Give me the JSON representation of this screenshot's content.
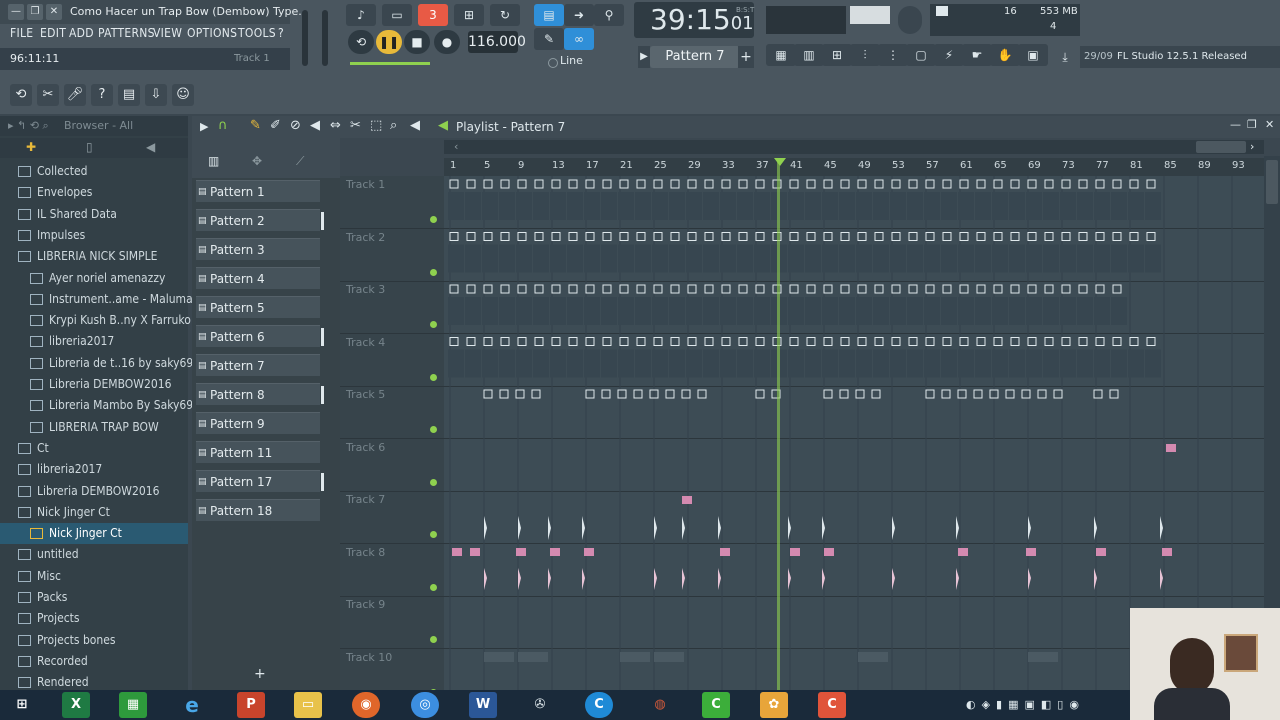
{
  "window": {
    "title": "Como Hacer un  Trap Bow (Dembow) Type..."
  },
  "menu": [
    "FILE",
    "EDIT",
    "ADD",
    "PATTERNS",
    "VIEW",
    "OPTIONS",
    "TOOLS",
    "?"
  ],
  "hint": {
    "position": "96:11:11",
    "track": "Track 1"
  },
  "transport": {
    "tempo": "116.000",
    "time": "39:15",
    "time_small": "01",
    "bst": "B:S:T",
    "snap": "Line"
  },
  "pattern_selector": "Pattern 7",
  "status": {
    "cpu": "16",
    "memory": "553 MB",
    "polyphony": "4"
  },
  "news": {
    "date": "29/09",
    "text": "FL Studio 12.5.1 Released"
  },
  "browser": {
    "header": "Browser - All",
    "items": [
      {
        "label": "Collected",
        "level": 0,
        "selected": false
      },
      {
        "label": "Envelopes",
        "level": 0,
        "selected": false
      },
      {
        "label": "IL Shared Data",
        "level": 0,
        "selected": false
      },
      {
        "label": "Impulses",
        "level": 0,
        "selected": false
      },
      {
        "label": "LIBRERIA NICK SIMPLE",
        "level": 0,
        "selected": false
      },
      {
        "label": "Ayer noriel amenazzy",
        "level": 1,
        "selected": false
      },
      {
        "label": "Instrument..ame - Maluma",
        "level": 1,
        "selected": false
      },
      {
        "label": "Krypi Kush B..ny X Farruko",
        "level": 1,
        "selected": false
      },
      {
        "label": "libreria2017",
        "level": 1,
        "selected": false
      },
      {
        "label": "Libreria de t..16 by saky69",
        "level": 1,
        "selected": false
      },
      {
        "label": "Libreria DEMBOW2016",
        "level": 1,
        "selected": false
      },
      {
        "label": "Libreria Mambo By Saky69",
        "level": 1,
        "selected": false
      },
      {
        "label": "LIBRERIA TRAP BOW",
        "level": 1,
        "selected": false
      },
      {
        "label": "Ct",
        "level": 0,
        "selected": false
      },
      {
        "label": "libreria2017",
        "level": 0,
        "selected": false
      },
      {
        "label": "Libreria DEMBOW2016",
        "level": 0,
        "selected": false
      },
      {
        "label": "Nick Jinger Ct",
        "level": 0,
        "selected": false
      },
      {
        "label": "Nick Jinger Ct",
        "level": 1,
        "selected": true
      },
      {
        "label": "untitled",
        "level": 0,
        "selected": false
      },
      {
        "label": "Misc",
        "level": 0,
        "selected": false
      },
      {
        "label": "Packs",
        "level": 0,
        "selected": false
      },
      {
        "label": "Projects",
        "level": 0,
        "selected": false
      },
      {
        "label": "Projects bones",
        "level": 0,
        "selected": false
      },
      {
        "label": "Recorded",
        "level": 0,
        "selected": false
      },
      {
        "label": "Rendered",
        "level": 0,
        "selected": false
      }
    ]
  },
  "patterns": [
    {
      "label": "Pattern 1",
      "active": false
    },
    {
      "label": "Pattern 2",
      "active": true
    },
    {
      "label": "Pattern 3",
      "active": false
    },
    {
      "label": "Pattern 4",
      "active": false
    },
    {
      "label": "Pattern 5",
      "active": false
    },
    {
      "label": "Pattern 6",
      "active": true
    },
    {
      "label": "Pattern 7",
      "active": false
    },
    {
      "label": "Pattern 8",
      "active": true
    },
    {
      "label": "Pattern 9",
      "active": false
    },
    {
      "label": "Pattern 11",
      "active": false
    },
    {
      "label": "Pattern 17",
      "active": true
    },
    {
      "label": "Pattern 18",
      "active": false
    }
  ],
  "playlist": {
    "title": "Playlist - Pattern 7",
    "ruler": [
      "1",
      "5",
      "9",
      "13",
      "17",
      "21",
      "25",
      "29",
      "33",
      "37",
      "41",
      "45",
      "49",
      "53",
      "57",
      "61",
      "65",
      "69",
      "73",
      "77",
      "81",
      "85",
      "89",
      "93"
    ],
    "tracks": [
      "Track 1",
      "Track 2",
      "Track 3",
      "Track 4",
      "Track 5",
      "Track 6",
      "Track 7",
      "Track 8",
      "Track 9",
      "Track 10"
    ]
  },
  "colors": {
    "accent_green": "#8fd14f",
    "selection_blue": "#2a5a72",
    "clip_pink": "#d48ab0",
    "clock_red": "#e85a45"
  }
}
